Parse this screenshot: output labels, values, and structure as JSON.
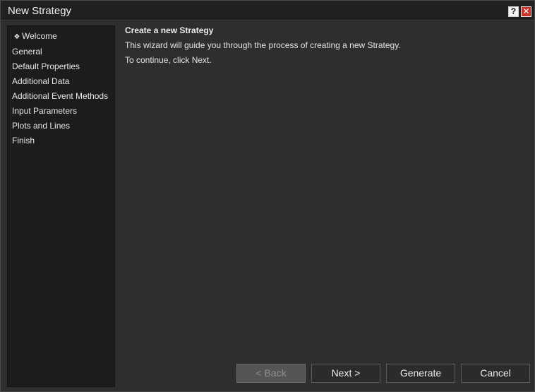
{
  "window": {
    "title": "New Strategy",
    "help_glyph": "?",
    "close_glyph": "✕"
  },
  "sidebar": {
    "items": [
      {
        "label": "Welcome",
        "bullet": "❖",
        "selected": true
      },
      {
        "label": "General"
      },
      {
        "label": "Default Properties"
      },
      {
        "label": "Additional Data"
      },
      {
        "label": "Additional Event Methods"
      },
      {
        "label": "Input Parameters"
      },
      {
        "label": "Plots and Lines"
      },
      {
        "label": "Finish"
      }
    ]
  },
  "content": {
    "heading": "Create a new Strategy",
    "line1": "This wizard will guide you through the process of creating a new Strategy.",
    "line2": "To continue, click Next."
  },
  "buttons": {
    "back": "< Back",
    "next": "Next >",
    "generate": "Generate",
    "cancel": "Cancel"
  },
  "colors": {
    "background": "#2e2e31",
    "sidebar": "#1c1c1c",
    "close": "#c8322a"
  }
}
